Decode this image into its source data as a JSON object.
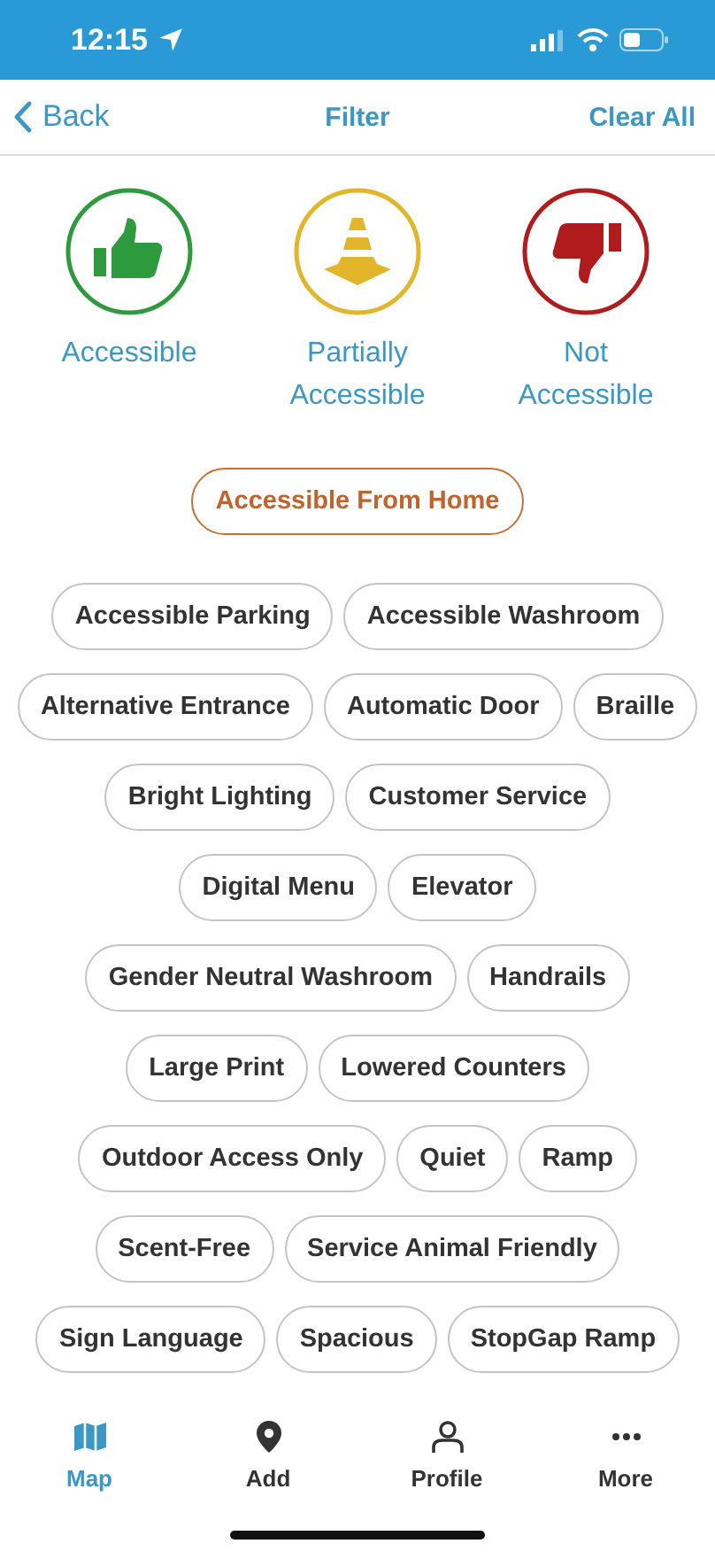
{
  "status_bar": {
    "time": "12:15"
  },
  "nav": {
    "back": "Back",
    "title": "Filter",
    "action": "Clear All"
  },
  "ratings": [
    {
      "kind": "accessible",
      "label": "Accessible",
      "color": "#2e9a3e",
      "selected": false
    },
    {
      "kind": "partial",
      "label": "Partially Accessible",
      "color": "#e2b52a",
      "selected": false
    },
    {
      "kind": "not",
      "label": "Not Accessible",
      "color": "#b01c1c",
      "selected": false
    }
  ],
  "home_filter": {
    "label": "Accessible From Home",
    "selected": false
  },
  "tag_rows": [
    [
      {
        "label": "Accessible Parking",
        "selected": false
      },
      {
        "label": "Accessible Washroom",
        "selected": false
      }
    ],
    [
      {
        "label": "Alternative Entrance",
        "selected": false
      },
      {
        "label": "Automatic Door",
        "selected": false
      },
      {
        "label": "Braille",
        "selected": false
      }
    ],
    [
      {
        "label": "Bright Lighting",
        "selected": false
      },
      {
        "label": "Customer Service",
        "selected": false
      }
    ],
    [
      {
        "label": "Digital Menu",
        "selected": false
      },
      {
        "label": "Elevator",
        "selected": false
      }
    ],
    [
      {
        "label": "Gender Neutral Washroom",
        "selected": false
      },
      {
        "label": "Handrails",
        "selected": false
      }
    ],
    [
      {
        "label": "Large Print",
        "selected": false
      },
      {
        "label": "Lowered Counters",
        "selected": false
      }
    ],
    [
      {
        "label": "Outdoor Access Only",
        "selected": false
      },
      {
        "label": "Quiet",
        "selected": false
      },
      {
        "label": "Ramp",
        "selected": false
      }
    ],
    [
      {
        "label": "Scent-Free",
        "selected": false
      },
      {
        "label": "Service Animal Friendly",
        "selected": false
      }
    ],
    [
      {
        "label": "Sign Language",
        "selected": false
      },
      {
        "label": "Spacious",
        "selected": false
      },
      {
        "label": "StopGap Ramp",
        "selected": false
      }
    ]
  ],
  "tabs": [
    {
      "kind": "map",
      "label": "Map",
      "selected": true
    },
    {
      "kind": "add",
      "label": "Add",
      "selected": false
    },
    {
      "kind": "profile",
      "label": "Profile",
      "selected": false
    },
    {
      "kind": "more",
      "label": "More",
      "selected": false
    }
  ]
}
